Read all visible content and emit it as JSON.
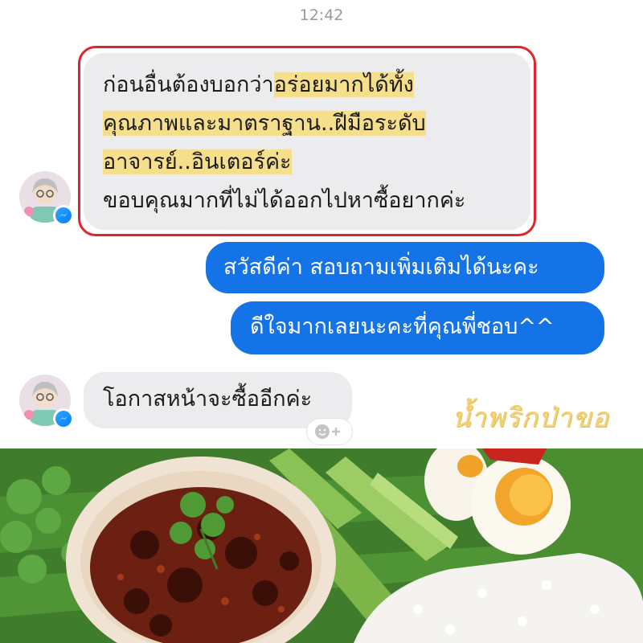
{
  "header": {
    "timestamp": "12:42"
  },
  "messages": {
    "received_1": {
      "lines": [
        {
          "pre": "ก่อนอื่นต้องบอกว่า",
          "hl": "อร่อยมากได้ทั้ง"
        },
        {
          "pre": "",
          "hl": "คุณภาพและมาตราฐาน..ฝีมือระดับ"
        },
        {
          "pre": "",
          "hl": "อาจารย์..อินเตอร์ค่ะ"
        },
        {
          "pre": "ขอบคุณมากที่ไม่ได้ออกไปหาซื้อยากค่ะ",
          "hl": ""
        }
      ]
    },
    "sent_1": "สวัสดีค่า สอบถามเพิ่มเติมได้นะคะ",
    "sent_2": "ดีใจมากเลยนะคะที่คุณพี่ชอบ^^",
    "received_2": "โอกาสหน้าจะซื้ออีกค่ะ"
  },
  "watermark": "น้ำพริกป่าขอ",
  "icons": {
    "avatar": "avatar-icon",
    "messenger_badge": "messenger-icon",
    "reaction": "add-reaction-icon"
  },
  "colors": {
    "sent_bubble": "#1473e6",
    "received_bubble": "#ececee",
    "highlight_frame": "#e3232b",
    "text_highlight": "#f6df8c"
  }
}
